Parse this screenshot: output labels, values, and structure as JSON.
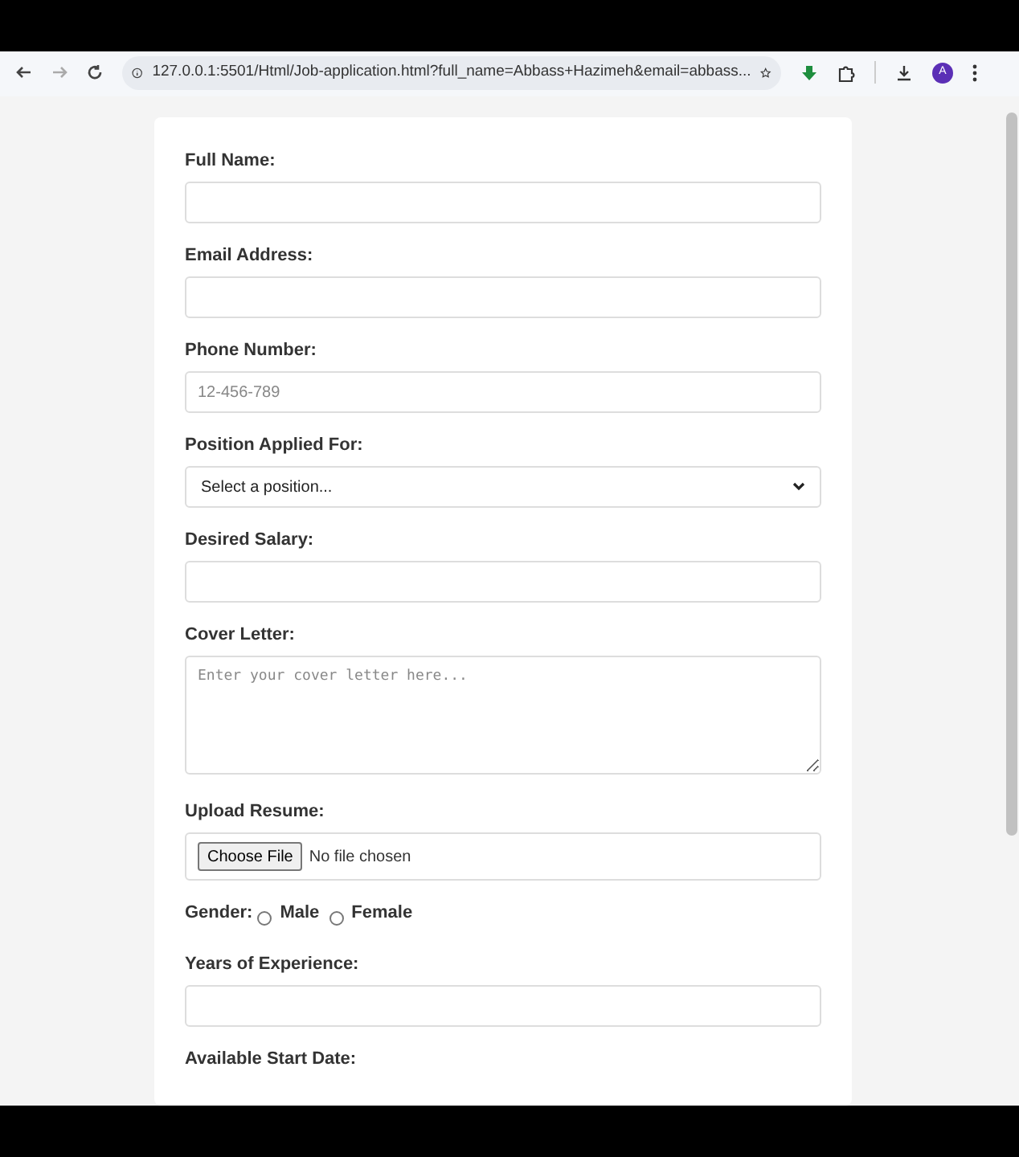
{
  "browser": {
    "url": "127.0.0.1:5501/Html/Job-application.html?full_name=Abbass+Hazimeh&email=abbass...",
    "profile_initial": "A"
  },
  "form": {
    "fields": [
      {
        "kind": "text",
        "label": "Full Name:"
      },
      {
        "kind": "text",
        "label": "Email Address:"
      },
      {
        "kind": "text",
        "label": "Phone Number:",
        "placeholder": "12-456-789"
      },
      {
        "kind": "select",
        "label": "Position Applied For:",
        "value": "Select a position..."
      },
      {
        "kind": "text",
        "label": "Desired Salary:"
      },
      {
        "kind": "textarea",
        "label": "Cover Letter:",
        "placeholder": "Enter your cover letter here..."
      },
      {
        "kind": "file",
        "label": "Upload Resume:",
        "button": "Choose File",
        "status": "No file chosen"
      },
      {
        "kind": "radio",
        "label": "Gender:",
        "options": [
          {
            "label": "Male",
            "selected": false
          },
          {
            "label": "Female",
            "selected": false
          }
        ]
      },
      {
        "kind": "text",
        "label": "Years of Experience:"
      },
      {
        "kind": "label",
        "label": "Available Start Date:"
      }
    ]
  }
}
